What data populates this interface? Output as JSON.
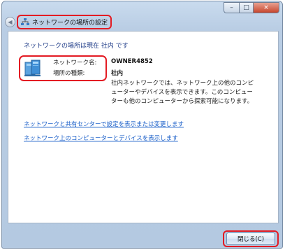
{
  "window": {
    "title": "ネットワークの場所の設定",
    "caption_buttons": {
      "minimize": "–",
      "maximize": "□",
      "close": "×"
    }
  },
  "status_line": "ネットワークの場所は現在 社内 です",
  "network": {
    "name_label": "ネットワーク名:",
    "name_value": "OWNER4852",
    "type_label": "場所の種類:",
    "type_value": "社内",
    "description": "社内ネットワークでは、ネットワーク上の他のコンピューターやデバイスを表示できます。このコンピューターも他のコンピューターから探索可能になります。"
  },
  "links": {
    "network_center": "ネットワークと共有センターで設定を表示または変更します",
    "view_computers": "ネットワーク上のコンピューターとデバイスを表示します"
  },
  "footer": {
    "close_label": "閉じる(C)"
  },
  "icons": {
    "back": "back-arrow-icon",
    "title": "network-icon",
    "network": "network-computer-icon"
  },
  "colors": {
    "highlight": "#e31b23",
    "link": "#1a5fc9",
    "status_text": "#1f3c88"
  }
}
